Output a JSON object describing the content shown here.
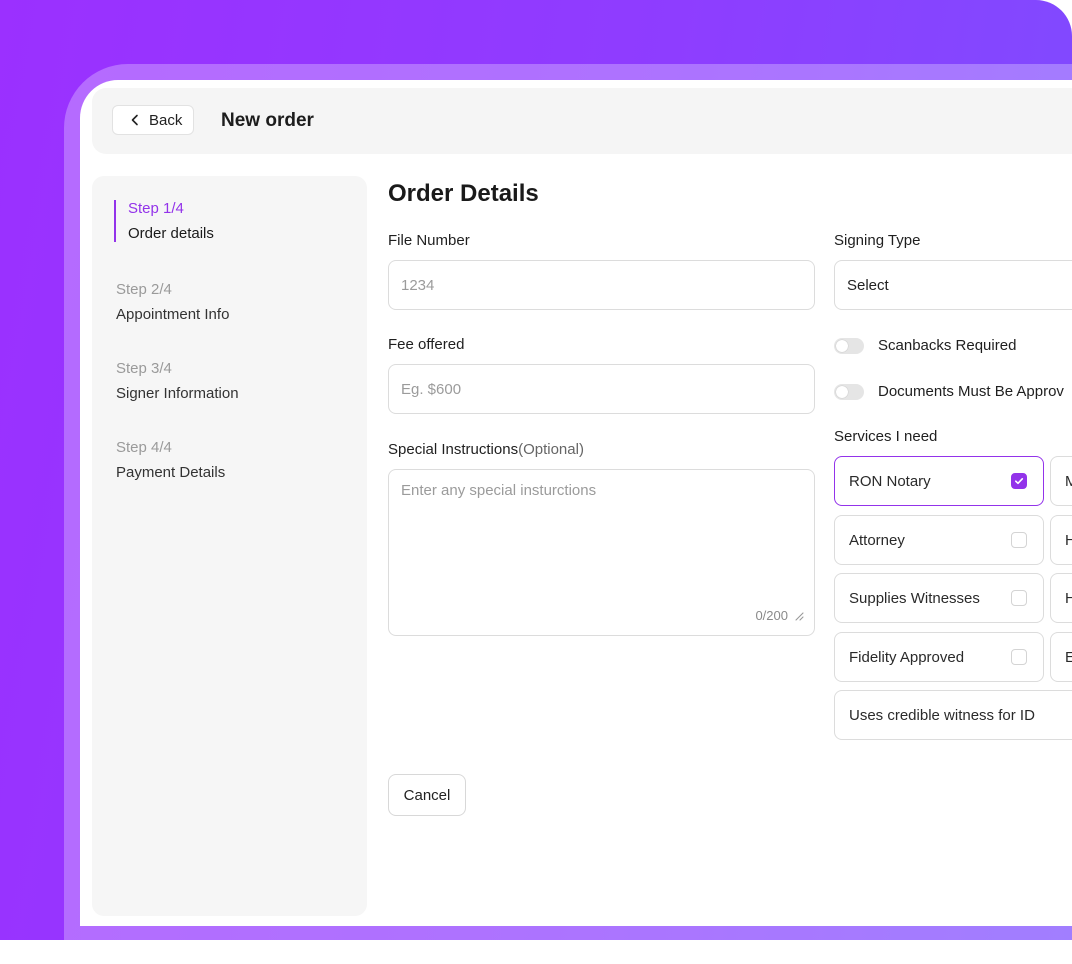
{
  "header": {
    "back_label": "Back",
    "title": "New order"
  },
  "steps": [
    {
      "num": "Step 1/4",
      "label": "Order details"
    },
    {
      "num": "Step 2/4",
      "label": "Appointment Info"
    },
    {
      "num": "Step 3/4",
      "label": "Signer Information"
    },
    {
      "num": "Step 4/4",
      "label": "Payment Details"
    }
  ],
  "form": {
    "heading": "Order Details",
    "file_number": {
      "label": "File Number",
      "placeholder": "1234"
    },
    "fee": {
      "label": "Fee offered",
      "placeholder": "Eg. $600"
    },
    "instructions": {
      "label": "Special Instructions",
      "optional": "(Optional)",
      "placeholder": "Enter any special insturctions",
      "counter": "0/200"
    },
    "signing_type": {
      "label": "Signing Type",
      "value": "Select"
    },
    "toggles": [
      {
        "label": "Scanbacks Required"
      },
      {
        "label": "Documents Must Be Approv"
      }
    ],
    "services_label": "Services I need",
    "services": [
      {
        "label": "RON Notary",
        "checked": true
      },
      {
        "label": "Attorney",
        "checked": false
      },
      {
        "label": "Supplies Witnesses",
        "checked": false
      },
      {
        "label": "Fidelity Approved",
        "checked": false
      },
      {
        "label": "Uses credible witness for ID"
      }
    ],
    "services_col2": [
      "M",
      "H",
      "H",
      "E"
    ],
    "cancel_label": "Cancel"
  },
  "colors": {
    "accent": "#9333ea",
    "gradient_start": "#9b30ff",
    "gradient_end": "#7d4dff"
  }
}
